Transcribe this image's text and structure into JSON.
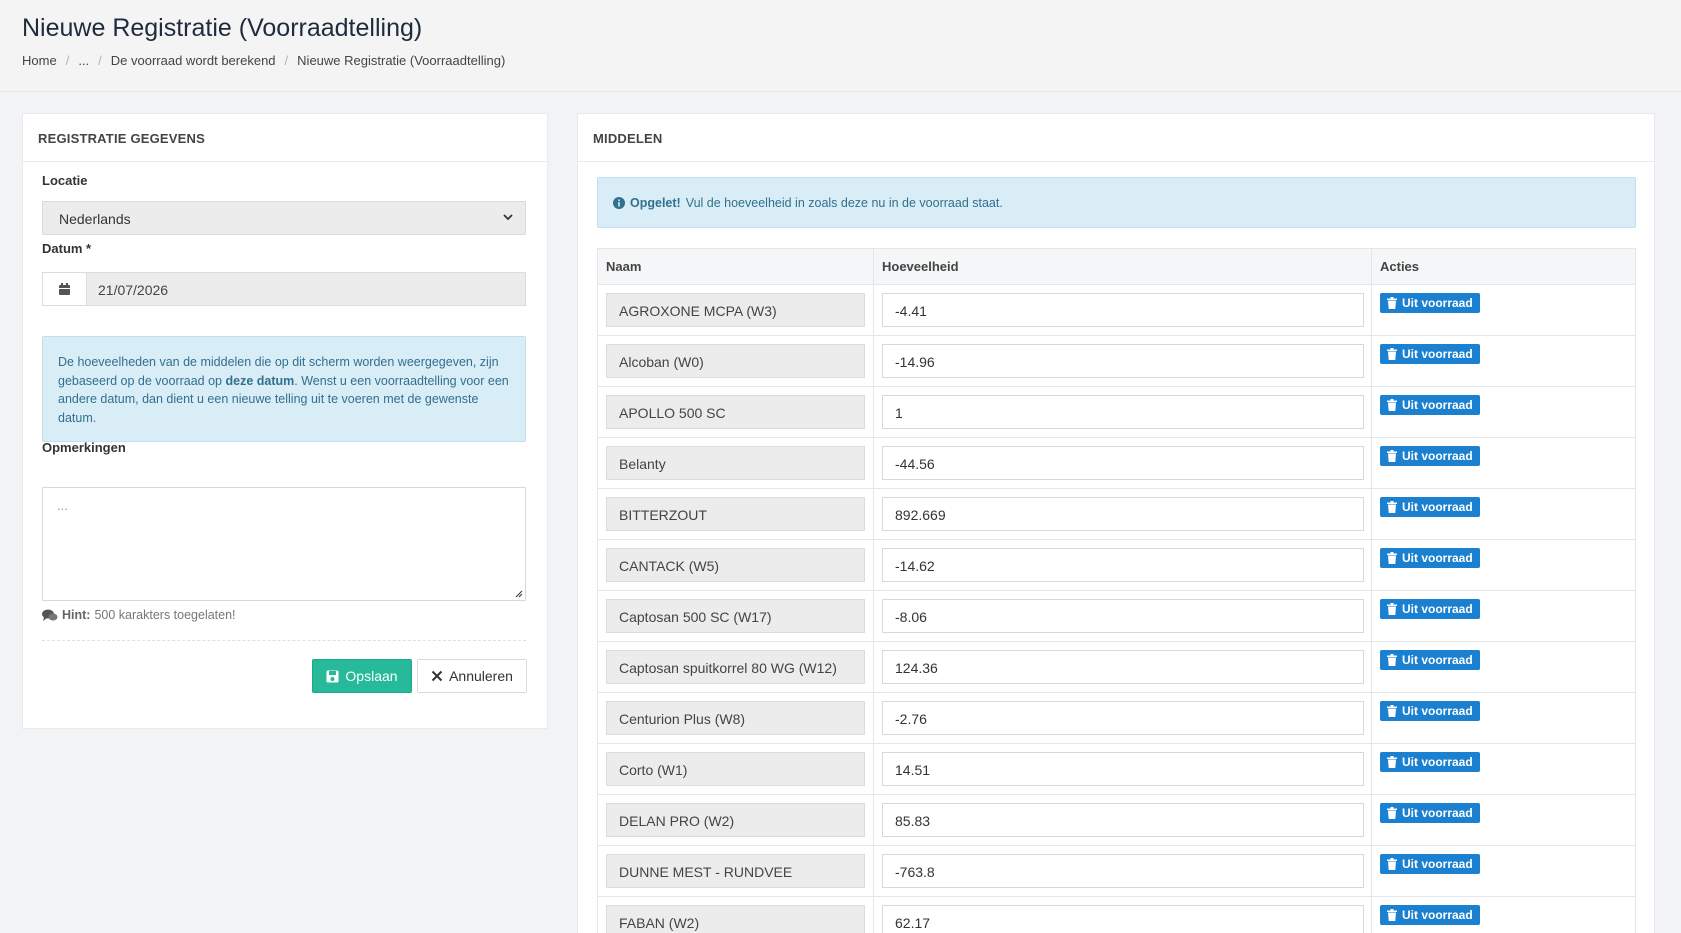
{
  "page": {
    "title": "Nieuwe Registratie (Voorraadtelling)",
    "breadcrumb": [
      "Home",
      "...",
      "De voorraad wordt berekend",
      "Nieuwe Registratie (Voorraadtelling)"
    ]
  },
  "left": {
    "title": "REGISTRATIE GEGEVENS",
    "locatie_label": "Locatie",
    "locatie_value": "Nederlands",
    "datum_label": "Datum *",
    "datum_value": "21/07/2026",
    "info_part1": "De hoeveelheden van de middelen die op dit scherm worden weergegeven, zijn gebaseerd op de voorraad op ",
    "info_bold": "deze datum",
    "info_part2": ". Wenst u een voorraadtelling voor een andere datum, dan dient u een nieuwe telling uit te voeren met de gewenste datum.",
    "opmerkingen_label": "Opmerkingen",
    "opmerkingen_placeholder": "...",
    "hint_bold": "Hint:",
    "hint_text": "500 karakters toegelaten!",
    "save_label": "Opslaan",
    "cancel_label": "Annuleren"
  },
  "right": {
    "title": "MIDDELEN",
    "alert_bold": "Opgelet!",
    "alert_text": "Vul de hoeveelheid in zoals deze nu in de voorraad staat.",
    "columns": [
      "Naam",
      "Hoeveelheid",
      "Acties"
    ],
    "action_label": "Uit voorraad",
    "rows": [
      {
        "name": "AGROXONE MCPA (W3)",
        "qty": "-4.41"
      },
      {
        "name": "Alcoban (W0)",
        "qty": "-14.96"
      },
      {
        "name": "APOLLO 500 SC",
        "qty": "1"
      },
      {
        "name": "Belanty",
        "qty": "-44.56"
      },
      {
        "name": "BITTERZOUT",
        "qty": "892.669"
      },
      {
        "name": "CANTACK (W5)",
        "qty": "-14.62"
      },
      {
        "name": "Captosan 500 SC (W17)",
        "qty": "-8.06"
      },
      {
        "name": "Captosan spuitkorrel 80 WG (W12)",
        "qty": "124.36"
      },
      {
        "name": "Centurion Plus (W8)",
        "qty": "-2.76"
      },
      {
        "name": "Corto  (W1)",
        "qty": "14.51"
      },
      {
        "name": "DELAN PRO (W2)",
        "qty": "85.83"
      },
      {
        "name": "DUNNE MEST - RUNDVEE",
        "qty": "-763.8"
      },
      {
        "name": "FABAN (W2)",
        "qty": "62.17"
      }
    ]
  },
  "icons": {
    "calendar": "calendar-icon",
    "save": "floppy-icon",
    "cancel": "close-icon",
    "info": "info-circle-icon",
    "trash": "trash-icon",
    "hint": "comments-icon"
  },
  "colors": {
    "save_button": "#26b99a",
    "action_button": "#1a80cf",
    "info_bg": "#d9edf7",
    "info_text": "#31708f"
  }
}
